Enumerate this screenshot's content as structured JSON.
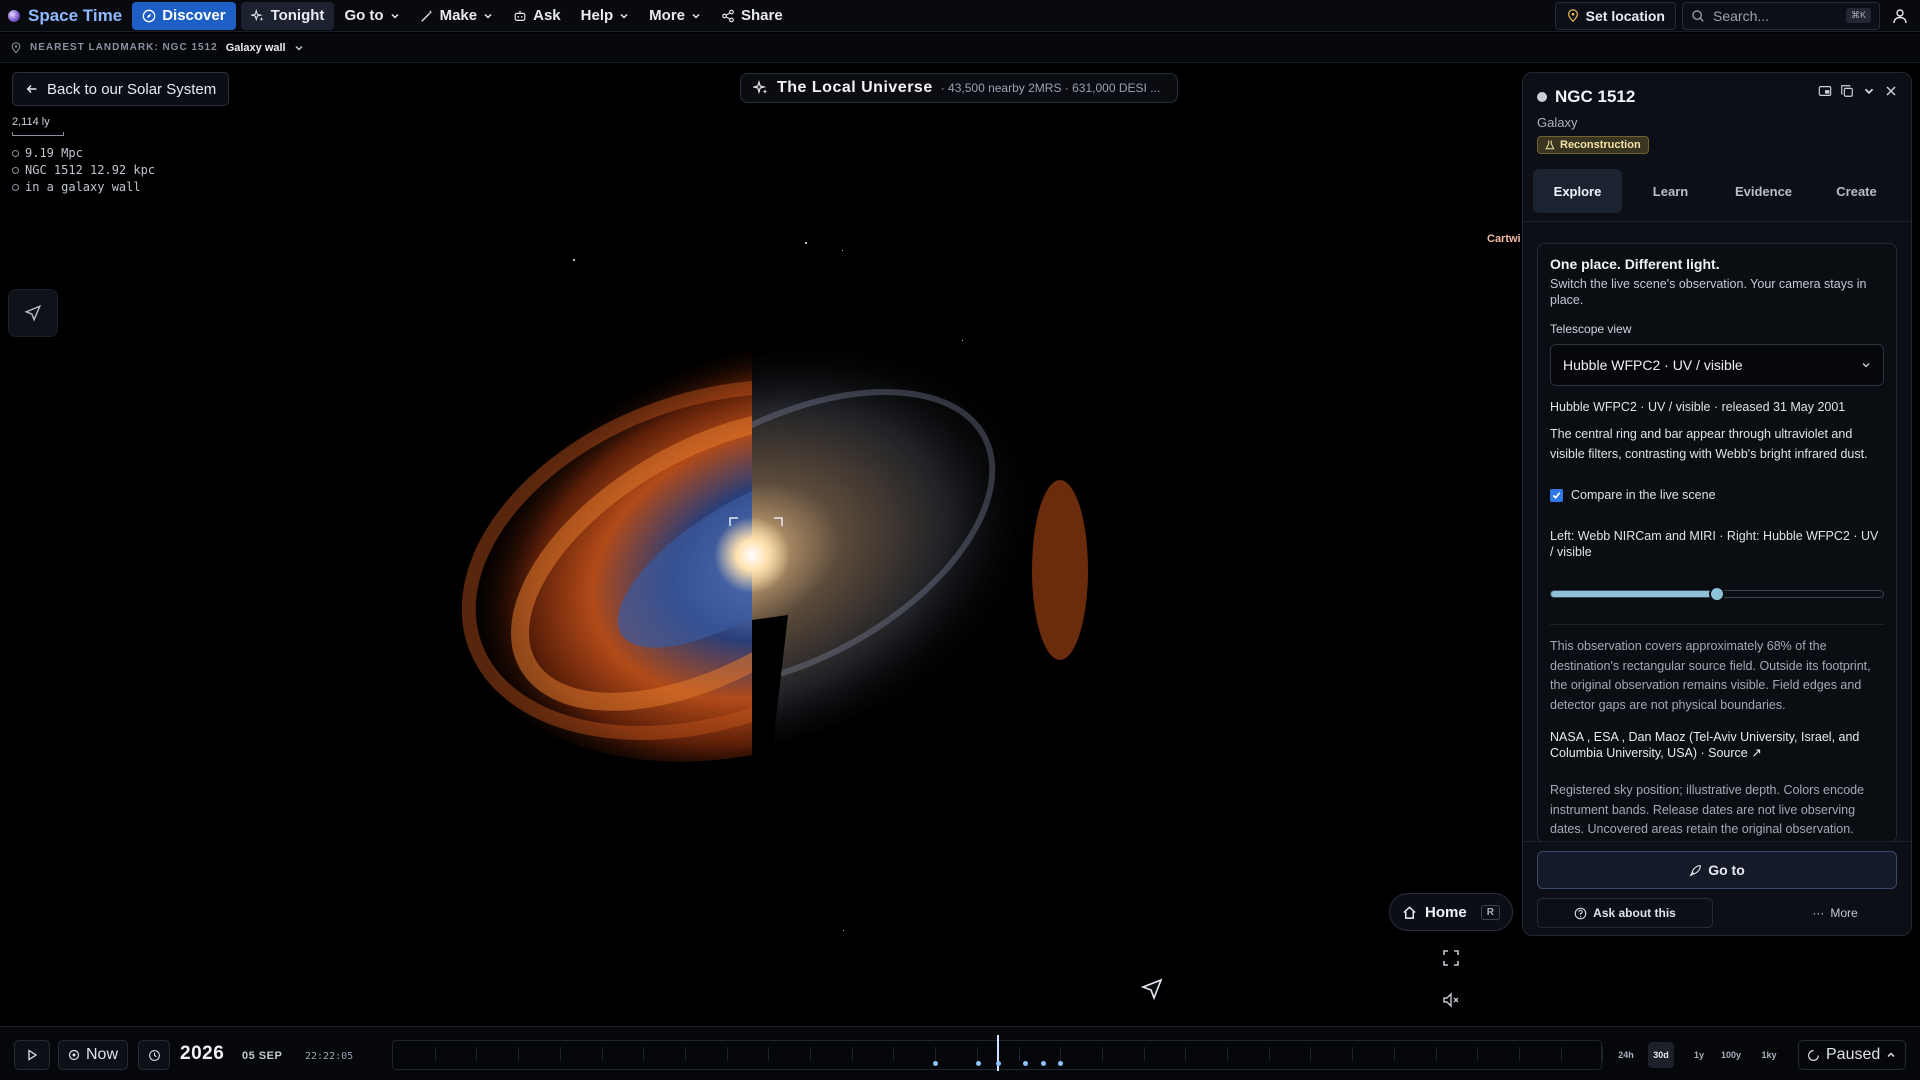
{
  "app": {
    "title": "Space Time"
  },
  "nav": {
    "discover": "Discover",
    "tonight": "Tonight",
    "goto": "Go to",
    "make": "Make",
    "ask": "Ask",
    "help": "Help",
    "more": "More",
    "share": "Share",
    "set_location": "Set location",
    "search_placeholder": "Search...",
    "search_kbd": "⌘K"
  },
  "landmark": {
    "label": "NEAREST LANDMARK: NGC 1512",
    "value": "Galaxy wall"
  },
  "back_button": "Back to our Solar System",
  "scale": {
    "label": "2,114 ly"
  },
  "stats": [
    "9.19 Mpc",
    "NGC 1512 12.92 kpc",
    "in a galaxy wall"
  ],
  "universe": {
    "title": "The Local Universe",
    "subtitle": "· 43,500 nearby 2MRS · 631,000 DESI ..."
  },
  "offscreen_label": "Cartwi",
  "panel": {
    "title": "NGC 1512",
    "subtitle": "Galaxy",
    "badge": "Reconstruction",
    "tabs": [
      "Explore",
      "Learn",
      "Evidence",
      "Create"
    ],
    "card": {
      "heading": "One place. Different light.",
      "intro": "Switch the live scene's observation. Your camera stays in place.",
      "scope_label": "Telescope view",
      "scope_value": "Hubble WFPC2 · UV / visible",
      "release": "Hubble WFPC2 · UV / visible · released 31 May 2001",
      "description": "The central ring and bar appear through ultraviolet and visible filters, contrasting with Webb's bright infrared dust.",
      "compare_label": "Compare in the live scene",
      "compare_checked": true,
      "compare_sides": "Left: Webb NIRCam and MIRI · Right: Hubble WFPC2 · UV / visible",
      "slider_fraction": 0.5,
      "coverage": "This observation covers approximately 68% of the destination's rectangular source field. Outside its footprint, the original observation remains visible. Field edges and detector gaps are not physical boundaries.",
      "credit": "NASA , ESA , Dan Maoz (Tel-Aviv University, Israel, and Columbia University, USA) · Source ↗",
      "note": "Registered sky position; illustrative depth. Colors encode instrument bands. Release dates are not live observing dates. Uncovered areas retain the original observation."
    },
    "goto": "Go to",
    "ask": "Ask about this",
    "more": "More"
  },
  "home": {
    "label": "Home",
    "kbd": "R"
  },
  "timeline": {
    "now": "Now",
    "year": "2026",
    "date": "05 SEP",
    "clock": "22:22:05",
    "zooms": [
      "24h",
      "30d",
      "1y",
      "100y",
      "1ky"
    ],
    "active_zoom": "30d",
    "status": "Paused"
  },
  "colors": {
    "accent": "#1d5fc4",
    "slider": "#8ec2d8",
    "badge_bg": "#3a3520"
  }
}
